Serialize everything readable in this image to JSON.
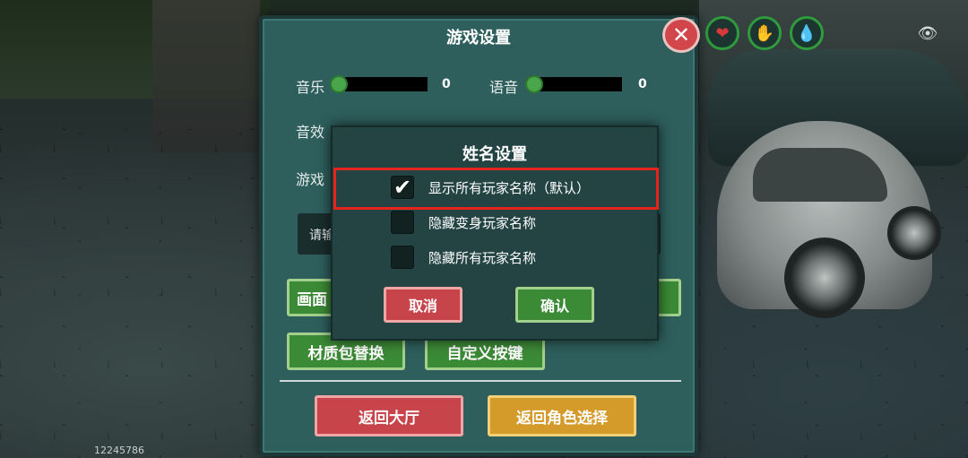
{
  "panel": {
    "title": "游戏设置",
    "close_label": "✕",
    "music_label": "音乐",
    "music_value": "0",
    "voice_label": "语音",
    "voice_value": "0",
    "sfx_label": "音效",
    "game_label": "游戏",
    "input_text": "请输",
    "graphics_label": "画面",
    "texture_pack_label": "材质包替换",
    "custom_keys_label": "自定义按键",
    "back_lobby_label": "返回大厅",
    "back_character_label": "返回角色选择"
  },
  "modal": {
    "title": "姓名设置",
    "options": [
      {
        "label": "显示所有玩家名称（默认）",
        "checked": true
      },
      {
        "label": "隐藏变身玩家名称",
        "checked": false
      },
      {
        "label": "隐藏所有玩家名称",
        "checked": false
      }
    ],
    "cancel_label": "取消",
    "confirm_label": "确认",
    "check_mark": "✔"
  },
  "hud": {
    "counter": "12245786",
    "icons": [
      "heart-icon",
      "hand-icon",
      "drop-icon",
      "eye-icon"
    ]
  },
  "colors": {
    "panel_bg": "#2e5f5d",
    "green_button": "#3b8a36",
    "red_button": "#c8444b",
    "orange_button": "#d49a2a",
    "highlight": "#e5241b"
  }
}
